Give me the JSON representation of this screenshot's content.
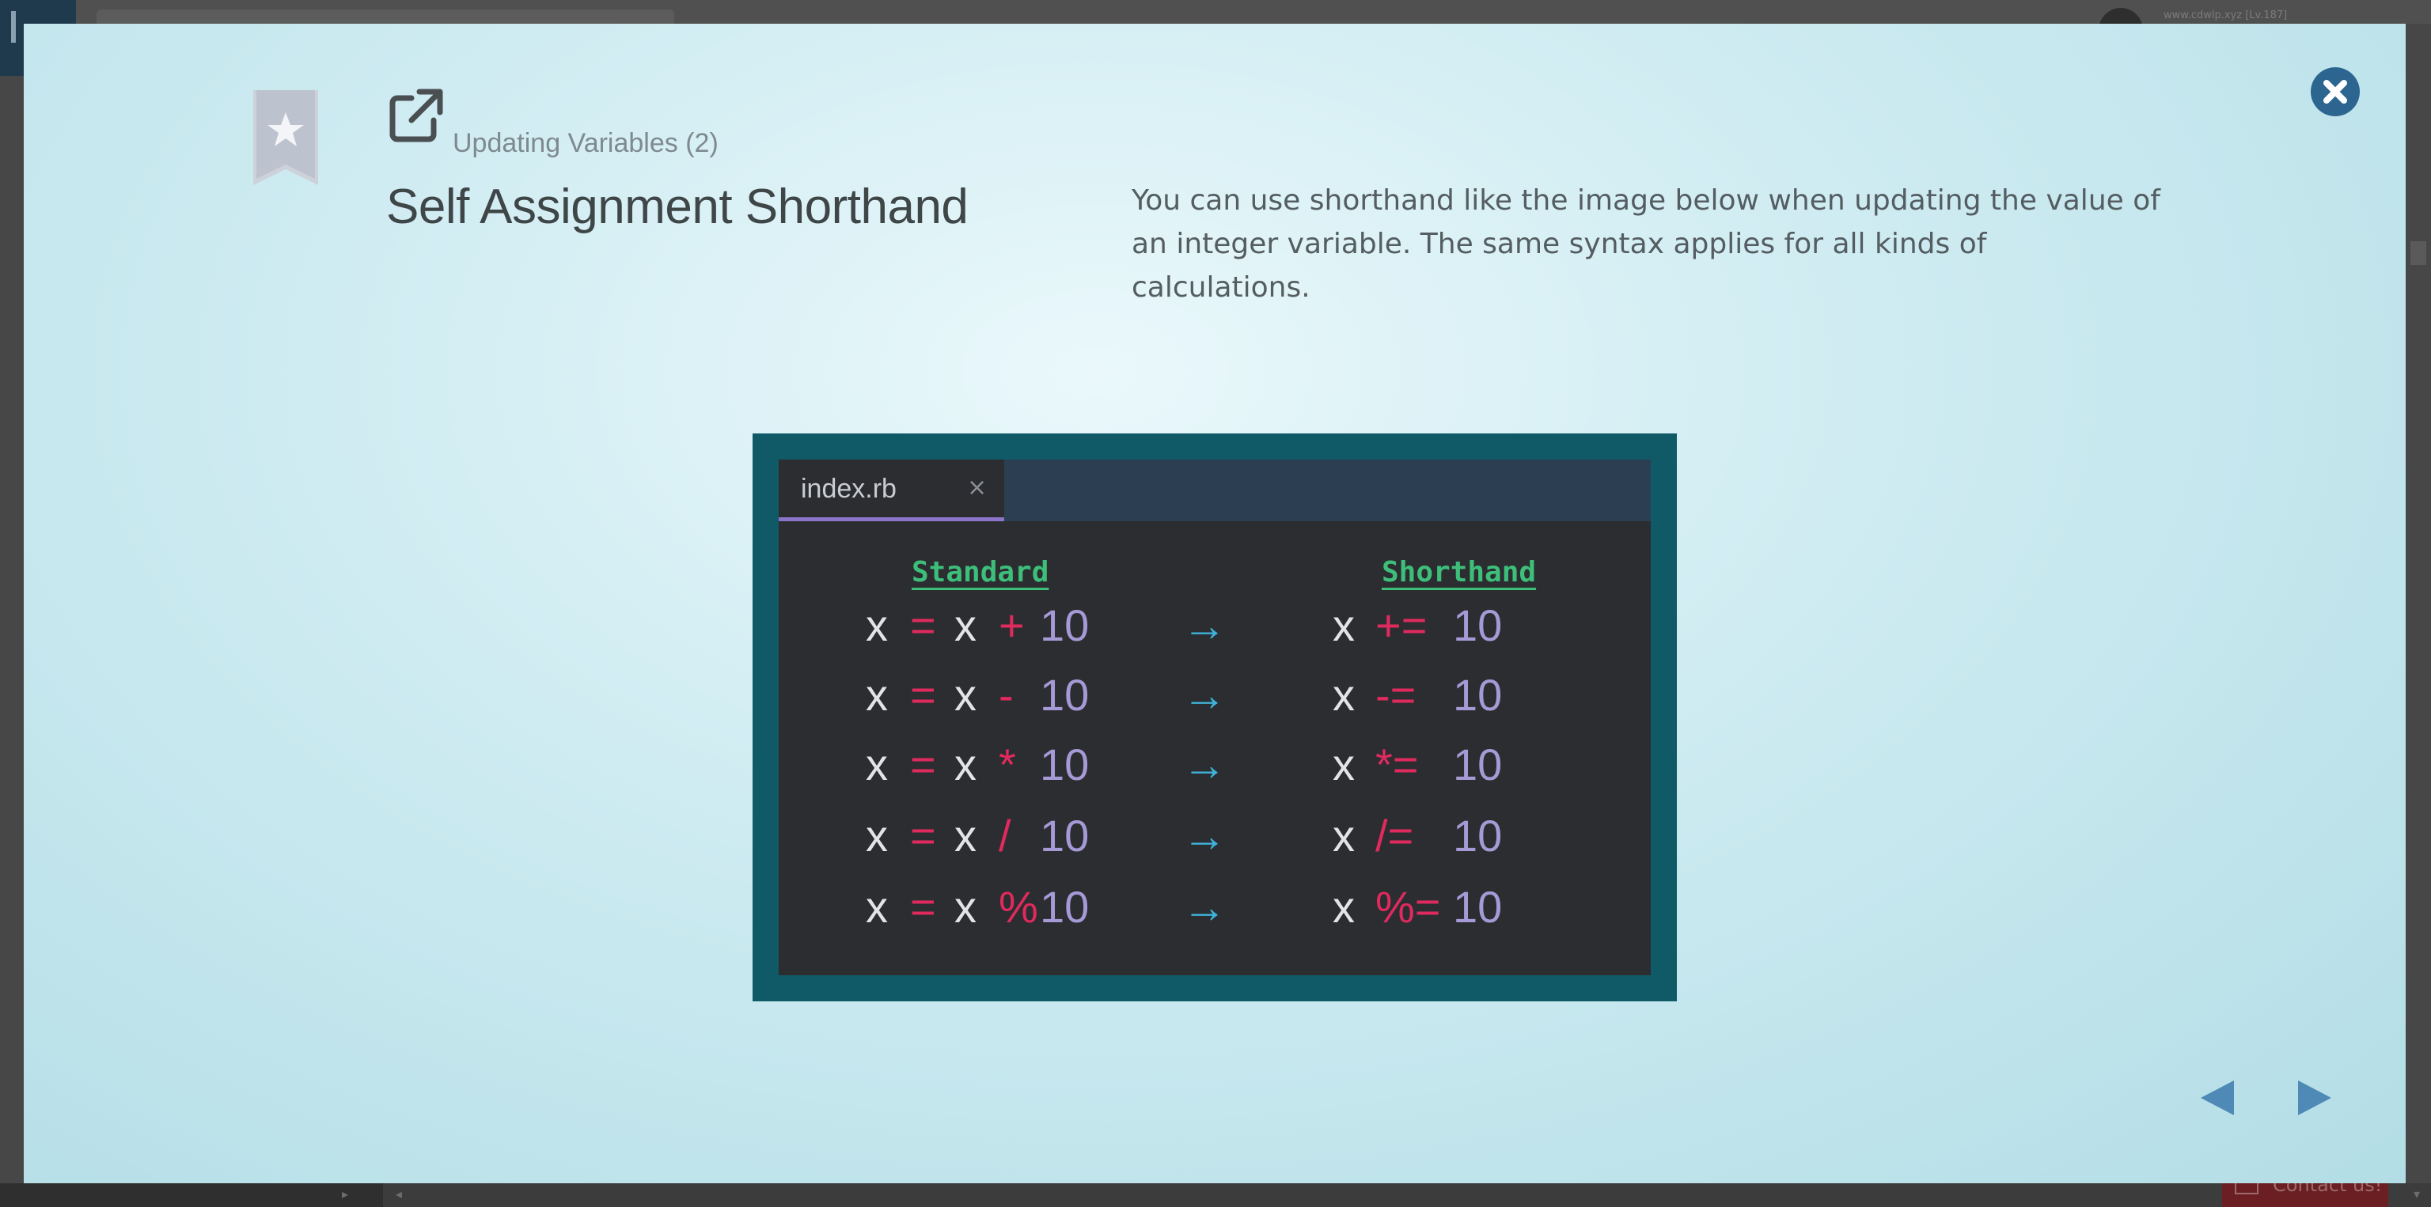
{
  "background": {
    "user_text": "www.cdwlp.xyz [Lv.187]",
    "contact_label": "Contact us!"
  },
  "modal": {
    "subtitle": "Updating Variables (2)",
    "title": "Self Assignment Shorthand",
    "description": "You can use shorthand like the image below when updating the value of an integer variable. The same syntax applies for all kinds of calculations.",
    "icons": {
      "bookmark": "star-bookmark-icon",
      "external": "external-link-icon",
      "close": "close-icon",
      "prev": "prev-arrow-icon",
      "next": "next-arrow-icon"
    }
  },
  "editor": {
    "tab_name": "index.rb",
    "tab_close": "×",
    "standard_heading": "Standard",
    "shorthand_heading": "Shorthand",
    "arrow": "→",
    "rows": [
      {
        "var": "x",
        "eq": "=",
        "var2": "x",
        "op": "+",
        "num": "10",
        "short_op": "+=",
        "short_num": "10"
      },
      {
        "var": "x",
        "eq": "=",
        "var2": "x",
        "op": "-",
        "num": "10",
        "short_op": "-=",
        "short_num": "10"
      },
      {
        "var": "x",
        "eq": "=",
        "var2": "x",
        "op": "*",
        "num": "10",
        "short_op": "*=",
        "short_num": "10"
      },
      {
        "var": "x",
        "eq": "=",
        "var2": "x",
        "op": "/",
        "num": "10",
        "short_op": "/=",
        "short_num": "10"
      },
      {
        "var": "x",
        "eq": "=",
        "var2": "x",
        "op": "%",
        "num": "10",
        "short_op": "%=",
        "short_num": "10"
      }
    ]
  },
  "colors": {
    "close_button": "#2c6690",
    "heading_green": "#3dbf7a",
    "operator_red": "#e02a5e",
    "number_purple": "#a69ad6",
    "arrow_blue": "#3fb2da",
    "tab_underline": "#8b74c9"
  }
}
